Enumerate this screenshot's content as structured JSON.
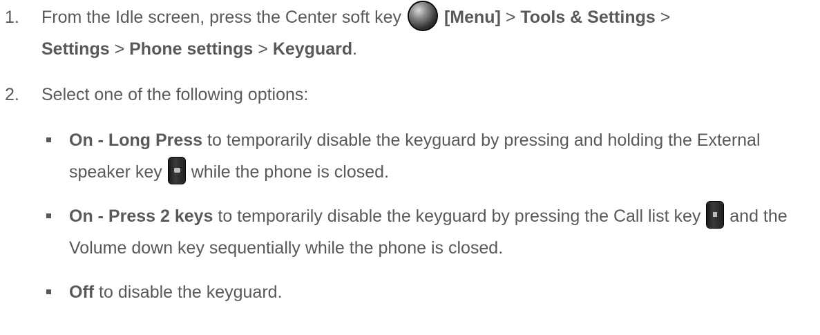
{
  "steps": [
    {
      "number": "1.",
      "text_a": "From the Idle screen, press the Center soft key ",
      "menu_label": "[Menu]",
      "sep1": " > ",
      "path1": "Tools & Settings",
      "sep2": " > ",
      "path2": "Settings",
      "sep3": " > ",
      "path3": "Phone settings",
      "sep4": " > ",
      "path4": "Keyguard",
      "end": "."
    },
    {
      "number": "2.",
      "text": "Select one of the following options:"
    }
  ],
  "options": [
    {
      "bold": "On - Long Press",
      "text_a": " to temporarily disable the keyguard by pressing and holding the External speaker key ",
      "text_b": " while the phone is closed."
    },
    {
      "bold": "On - Press 2 keys",
      "text_a": " to temporarily disable the keyguard by pressing the Call list key ",
      "text_b": " and the Volume down key sequentially while the phone is closed."
    },
    {
      "bold": "Off",
      "text_a": " to disable the keyguard."
    }
  ],
  "icons": {
    "center_key": "center-soft-key-icon",
    "speaker_key": "external-speaker-key-icon",
    "calllist_key": "call-list-key-icon"
  }
}
